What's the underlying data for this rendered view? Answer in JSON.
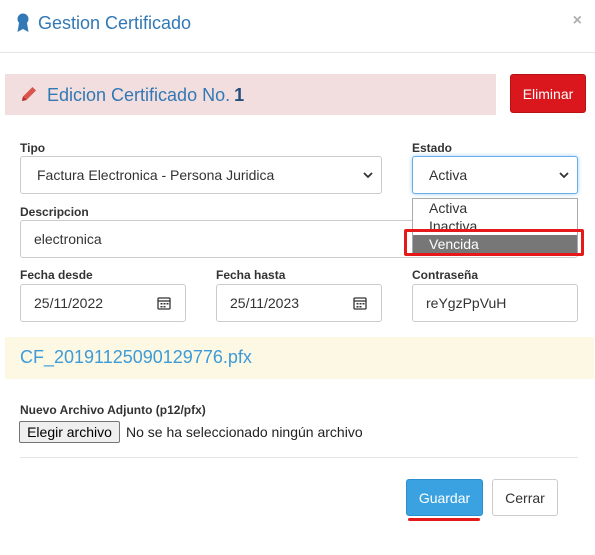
{
  "header": {
    "title": "Gestion Certificado",
    "close_label": "×"
  },
  "banner": {
    "text": "Edicion Certificado No.",
    "number": "1"
  },
  "delete_button": "Eliminar",
  "form": {
    "tipo": {
      "label": "Tipo",
      "value": "Factura Electronica - Persona Juridica"
    },
    "estado": {
      "label": "Estado",
      "value": "Activa",
      "options": [
        "Activa",
        "Inactiva",
        "Vencida"
      ],
      "highlighted": "Vencida"
    },
    "descripcion": {
      "label": "Descripcion",
      "value": "electronica"
    },
    "fecha_desde": {
      "label": "Fecha desde",
      "value": "25/11/2022"
    },
    "fecha_hasta": {
      "label": "Fecha hasta",
      "value": "25/11/2023"
    },
    "contrasena": {
      "label": "Contraseña",
      "value": "reYgzPpVuH"
    }
  },
  "current_file": "CF_20191125090129776.pfx",
  "attachment": {
    "label": "Nuevo Archivo Adjunto (p12/pfx)",
    "button": "Elegir archivo",
    "status": "No se ha seleccionado ningún archivo"
  },
  "footer": {
    "save": "Guardar",
    "close": "Cerrar"
  },
  "colors": {
    "primary": "#3aa2e1",
    "danger": "#d9171c",
    "title_blue": "#3178b5",
    "banner_bg": "#f2dede",
    "file_bg": "#fcf8e3"
  }
}
